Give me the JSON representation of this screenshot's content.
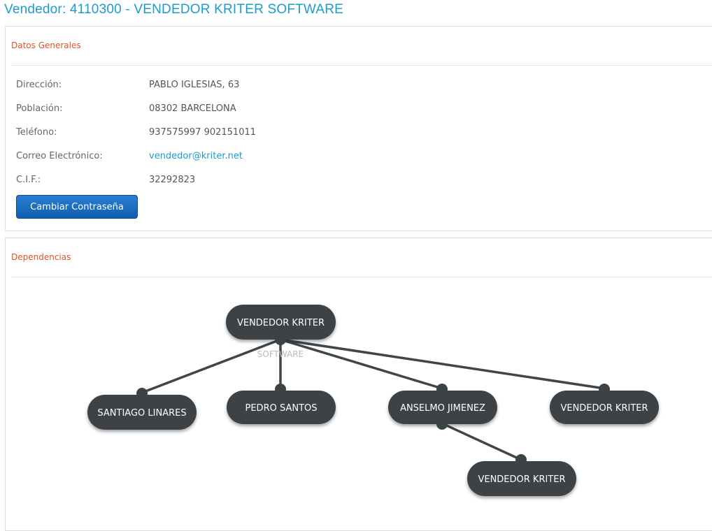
{
  "page": {
    "title": "Vendedor: 4110300 - VENDEDOR KRITER SOFTWARE"
  },
  "general": {
    "heading": "Datos Generales",
    "fields": [
      {
        "label": "Dirección:",
        "value": "PABLO IGLESIAS, 63"
      },
      {
        "label": "Población:",
        "value": "08302 BARCELONA"
      },
      {
        "label": "Teléfono:",
        "value": "937575997 902151011"
      },
      {
        "label": "Correo Electrónico:",
        "value": "vendedor@kriter.net"
      },
      {
        "label": "C.I.F.:",
        "value": "32292823"
      }
    ],
    "change_password_label": "Cambiar Contraseña"
  },
  "dependencies": {
    "heading": "Dependencias",
    "root": {
      "label": "VENDEDOR KRITER",
      "sublabel": "SOFTWARE"
    },
    "children": [
      {
        "label": "SANTIAGO LINARES"
      },
      {
        "label": "PEDRO SANTOS"
      },
      {
        "label": "ANSELMO JIMENEZ",
        "children": [
          {
            "label": "VENDEDOR KRITER"
          }
        ]
      },
      {
        "label": "VENDEDOR KRITER"
      }
    ]
  },
  "colors": {
    "title": "#1a9ccf",
    "heading": "#e0532a",
    "node": "#3c4347",
    "button": "#1565c0"
  }
}
